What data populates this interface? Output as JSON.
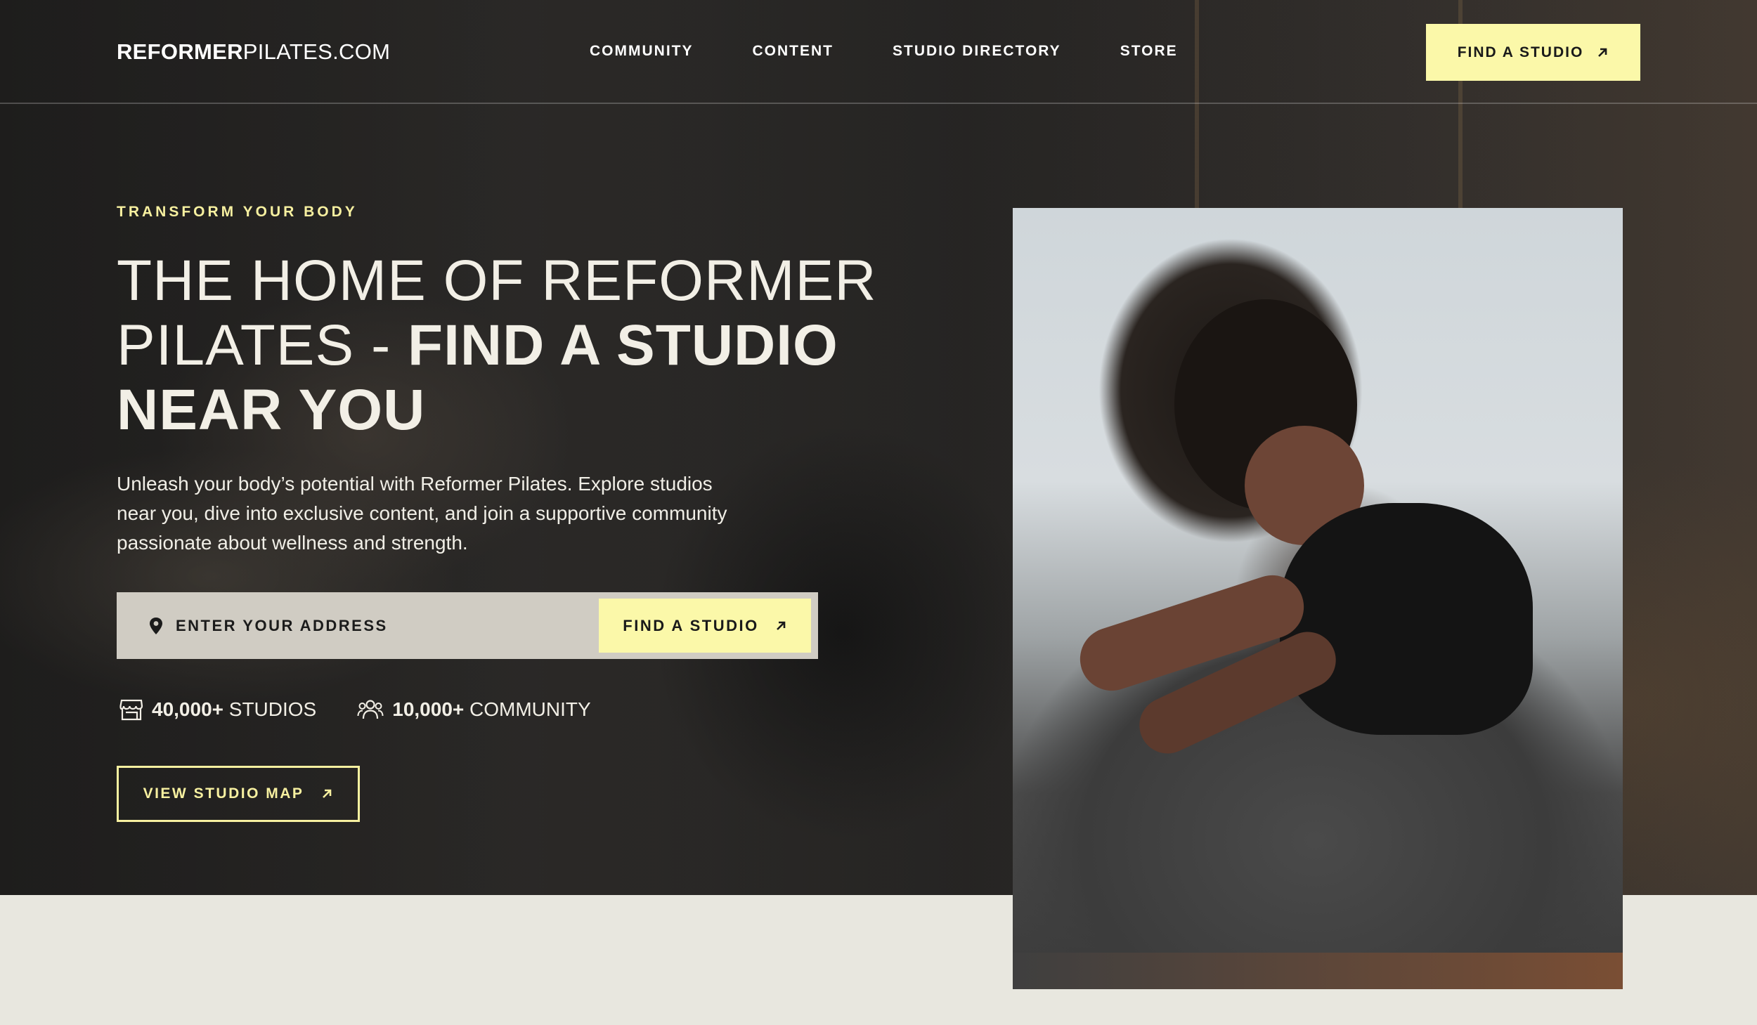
{
  "brand": {
    "bold": "REFORMER",
    "light": "PILATES.COM"
  },
  "nav": {
    "items": [
      {
        "label": "COMMUNITY"
      },
      {
        "label": "CONTENT"
      },
      {
        "label": "STUDIO DIRECTORY"
      },
      {
        "label": "STORE"
      }
    ],
    "cta_label": "FIND A STUDIO"
  },
  "hero": {
    "eyebrow": "TRANSFORM YOUR BODY",
    "headline_light": "THE HOME OF REFORMER PILATES - ",
    "headline_bold": "FIND A STUDIO NEAR YOU",
    "subtext": "Unleash your body’s potential with Reformer Pilates. Explore studios near you, dive into exclusive content, and join a supportive community passionate about wellness and strength."
  },
  "search": {
    "placeholder": "ENTER YOUR ADDRESS",
    "value": "",
    "button_label": "FIND A STUDIO"
  },
  "stats": [
    {
      "value": "40,000+",
      "label": "STUDIOS",
      "icon": "store-icon"
    },
    {
      "value": "10,000+",
      "label": "COMMUNITY",
      "icon": "people-icon"
    }
  ],
  "map_button": {
    "label": "VIEW STUDIO MAP"
  },
  "colors": {
    "accent": "#fbf8a9",
    "eyebrow": "#f7f0a0",
    "page_bg": "#e8e7df"
  }
}
